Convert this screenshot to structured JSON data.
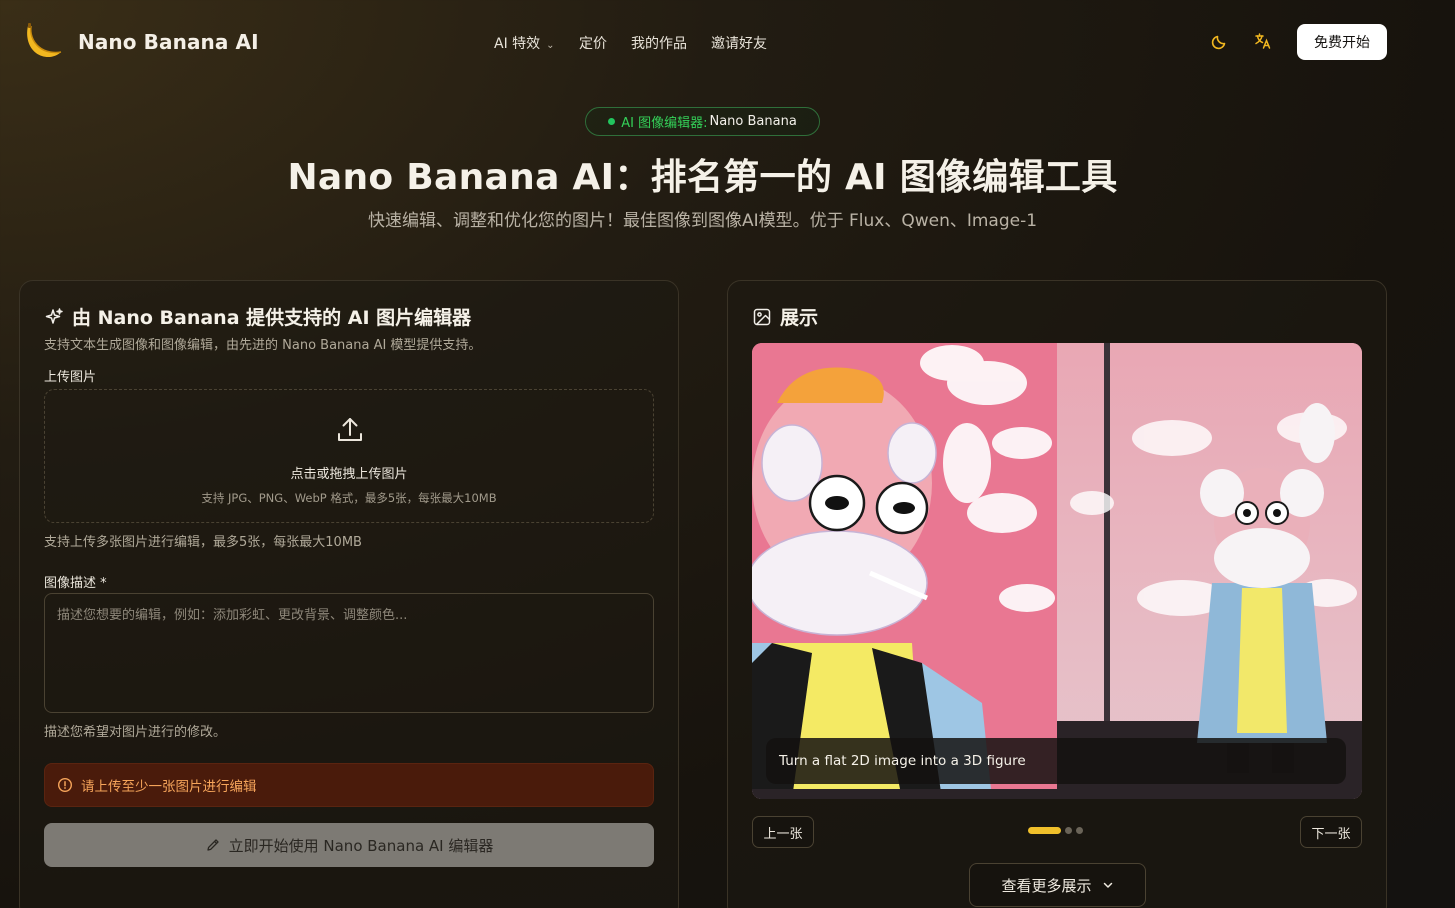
{
  "header": {
    "brand": "Nano Banana AI",
    "nav": {
      "effects": "AI 特效",
      "pricing": "定价",
      "works": "我的作品",
      "invite": "邀请好友"
    },
    "cta": "免费开始"
  },
  "hero": {
    "badge_green": "AI 图像编辑器:",
    "badge_white": "Nano Banana",
    "title": "Nano Banana AI：排名第一的 AI 图像编辑工具",
    "subtitle": "快速编辑、调整和优化您的图片！最佳图像到图像AI模型。优于 Flux、Qwen、Image-1"
  },
  "editor": {
    "title": "由 Nano Banana 提供支持的 AI 图片编辑器",
    "subtitle": "支持文本生成图像和图像编辑，由先进的 Nano Banana AI 模型提供支持。",
    "upload_label": "上传图片",
    "upload_main": "点击或拖拽上传图片",
    "upload_hint": "支持 JPG、PNG、WebP 格式，最多5张，每张最大10MB",
    "upload_note": "支持上传多张图片进行编辑，最多5张，每张最大10MB",
    "desc_label": "图像描述 *",
    "desc_placeholder": "描述您想要的编辑，例如：添加彩虹、更改背景、调整颜色...",
    "desc_value": "",
    "desc_note": "描述您希望对图片进行的修改。",
    "error": "请上传至少一张图片进行编辑",
    "start_button": "立即开始使用 Nano Banana AI 编辑器"
  },
  "showcase": {
    "title": "展示",
    "caption": "Turn a flat 2D image into a 3D figure",
    "prev": "上一张",
    "next": "下一张",
    "more": "查看更多展示",
    "current_slide": 1,
    "total_slides": 3
  },
  "colors": {
    "accent_yellow": "#f0c02b",
    "badge_green": "#34d058",
    "error_bg": "#4a1b0b",
    "error_text": "#f5a45a"
  }
}
